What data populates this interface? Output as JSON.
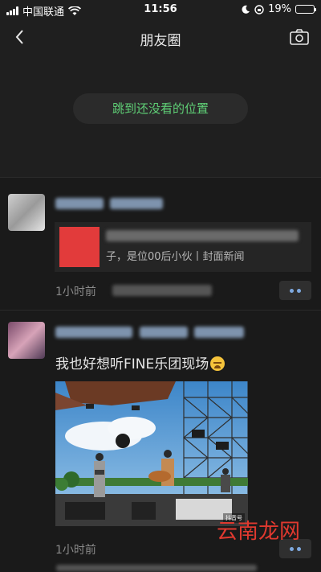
{
  "status_bar": {
    "carrier": "中国联通",
    "time": "11:56",
    "battery_percent": "19%",
    "battery_level": 0.19
  },
  "nav": {
    "title": "朋友圈"
  },
  "jump_pill": {
    "label": "跳到还没看的位置"
  },
  "posts": [
    {
      "share_card_text": "子，是位00后小伙丨封面新闻",
      "time": "1小时前"
    },
    {
      "text": "我也好想听FINE乐团现场",
      "photo_badge": "抖音号",
      "time": "1小时前"
    }
  ],
  "watermark": "云南龙网",
  "colors": {
    "accent_green": "#5fcf76",
    "background": "#111111",
    "panel": "#1f1f1f",
    "link_blue": "#7ea9e0"
  }
}
